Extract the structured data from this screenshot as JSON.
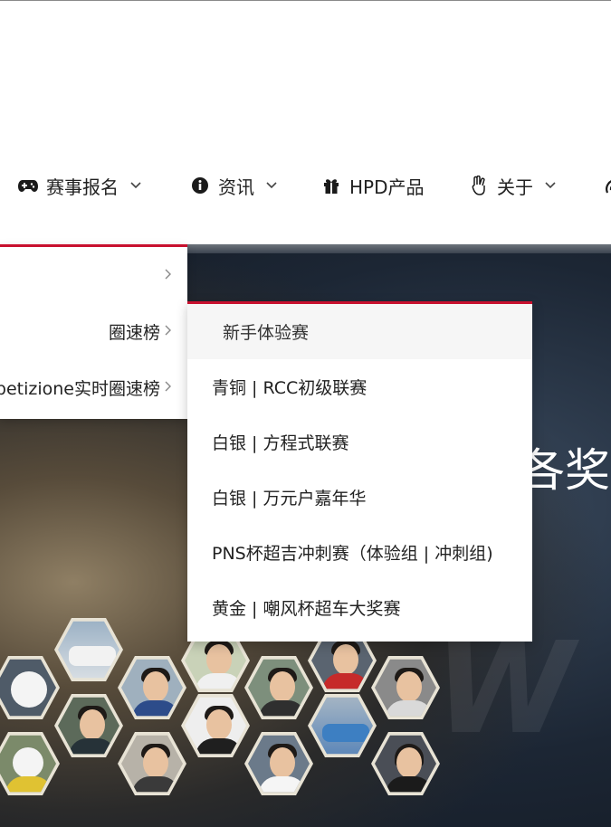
{
  "nav": {
    "items": [
      {
        "label": "赛事报名",
        "icon": "gamepad-icon",
        "has_dropdown": true
      },
      {
        "label": "资讯",
        "icon": "info-circle-icon",
        "has_dropdown": true
      },
      {
        "label": "HPD产品",
        "icon": "gift-icon",
        "has_dropdown": false
      },
      {
        "label": "关于",
        "icon": "peace-hand-icon",
        "has_dropdown": true
      }
    ],
    "partial_icon": "signal-icon"
  },
  "submenu": {
    "items": [
      {
        "label": "",
        "has_submenu": true
      },
      {
        "label": "圈速榜",
        "has_submenu": true
      },
      {
        "label": "petizione实时圈速榜",
        "has_submenu": true
      }
    ]
  },
  "flyout": {
    "items": [
      {
        "label": "新手体验赛",
        "active": true
      },
      {
        "label": "青铜 | RCC初级联赛",
        "active": false
      },
      {
        "label": "白银 | 方程式联赛",
        "active": false
      },
      {
        "label": "白银 | 万元户嘉年华",
        "active": false
      },
      {
        "label": "PNS杯超吉冲刺赛（体验组 | 冲刺组)",
        "active": false
      },
      {
        "label": "黄金 | 嘲风杯超车大奖赛",
        "active": false
      }
    ]
  },
  "hero": {
    "title": "各奖",
    "watermark": "W A"
  },
  "colors": {
    "accent": "#c8102e",
    "text": "#222222",
    "menu_active_bg": "#f6f6f6"
  }
}
